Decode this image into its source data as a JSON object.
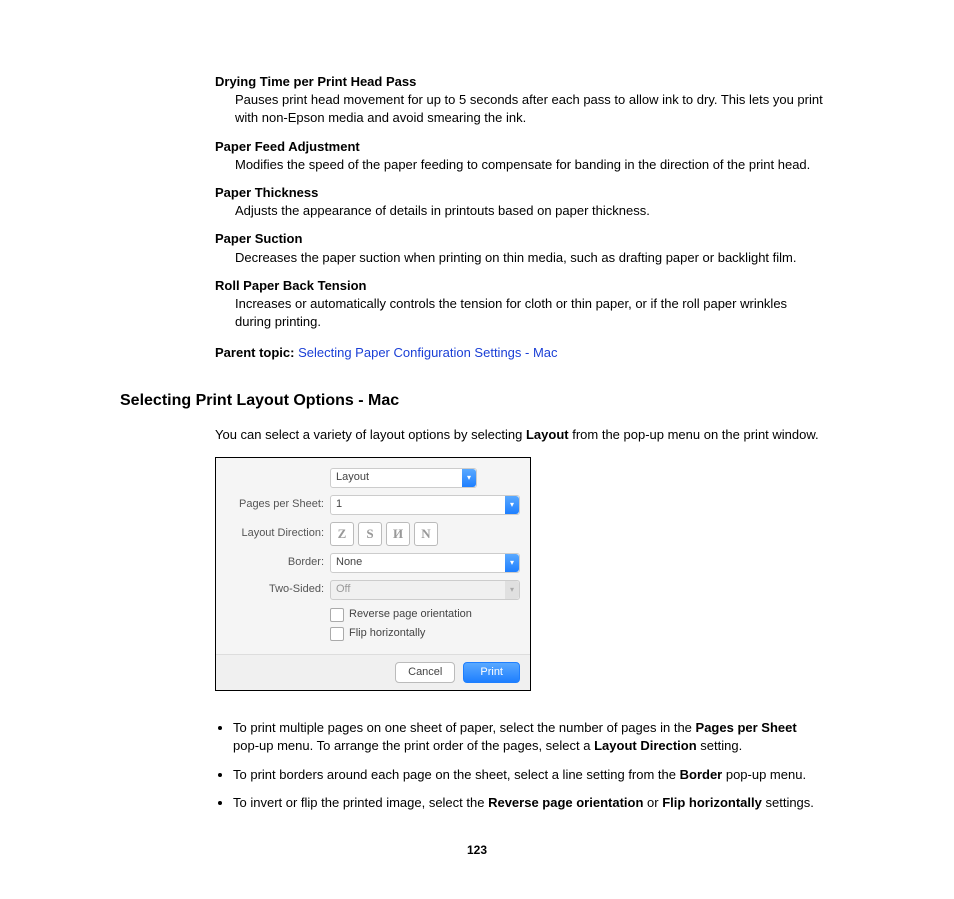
{
  "definitions": [
    {
      "term": "Drying Time per Print Head Pass",
      "desc": "Pauses print head movement for up to 5 seconds after each pass to allow ink to dry. This lets you print with non-Epson media and avoid smearing the ink."
    },
    {
      "term": "Paper Feed Adjustment",
      "desc": "Modifies the speed of the paper feeding to compensate for banding in the direction of the print head."
    },
    {
      "term": "Paper Thickness",
      "desc": "Adjusts the appearance of details in printouts based on paper thickness."
    },
    {
      "term": "Paper Suction",
      "desc": "Decreases the paper suction when printing on thin media, such as drafting paper or backlight film."
    },
    {
      "term": "Roll Paper Back Tension",
      "desc": "Increases or automatically controls the tension for cloth or thin paper, or if the roll paper wrinkles during printing."
    }
  ],
  "parent_topic": {
    "label": "Parent topic:",
    "link": "Selecting Paper Configuration Settings - Mac"
  },
  "h2": "Selecting Print Layout Options - Mac",
  "intro_a": "You can select a variety of layout options by selecting ",
  "intro_bold": "Layout",
  "intro_b": " from the pop-up menu on the print window.",
  "dialog": {
    "tab": "Layout",
    "pages_label": "Pages per Sheet:",
    "pages_value": "1",
    "dir_label": "Layout Direction:",
    "dir_icons": [
      "Z",
      "S",
      "И",
      "N"
    ],
    "border_label": "Border:",
    "border_value": "None",
    "two_label": "Two-Sided:",
    "two_value": "Off",
    "cb1": "Reverse page orientation",
    "cb2": "Flip horizontally",
    "cancel": "Cancel",
    "print": "Print"
  },
  "bullets": {
    "b1a": "To print multiple pages on one sheet of paper, select the number of pages in the ",
    "b1b": "Pages per Sheet",
    "b1c": " pop-up menu. To arrange the print order of the pages, select a ",
    "b1d": "Layout Direction",
    "b1e": " setting.",
    "b2a": "To print borders around each page on the sheet, select a line setting from the ",
    "b2b": "Border",
    "b2c": " pop-up menu.",
    "b3a": "To invert or flip the printed image, select the ",
    "b3b": "Reverse page orientation",
    "b3c": " or ",
    "b3d": "Flip horizontally",
    "b3e": " settings."
  },
  "page": "123"
}
